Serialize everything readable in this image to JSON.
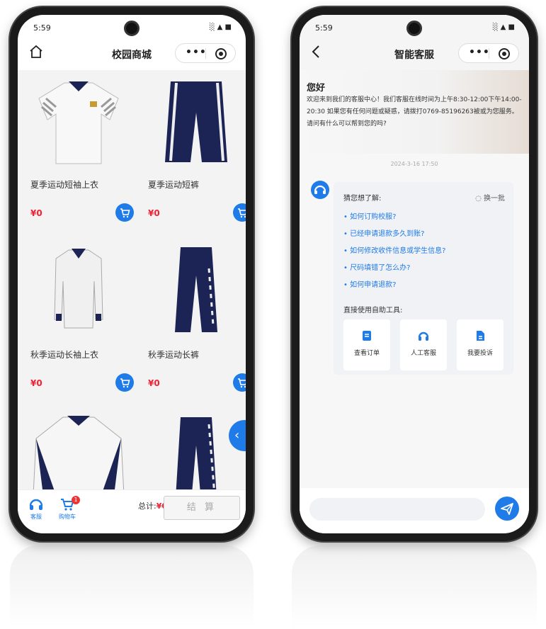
{
  "shop": {
    "status_time": "5:59",
    "status_icons": "░ ▲ ■",
    "title": "校园商城",
    "products": [
      {
        "name": "夏季运动短袖上衣",
        "price": "¥0"
      },
      {
        "name": "夏季运动短裤",
        "price": "¥0"
      },
      {
        "name": "秋季运动长袖上衣",
        "price": "¥0"
      },
      {
        "name": "秋季运动长裤",
        "price": "¥0"
      }
    ],
    "tab_service": "客服",
    "tab_cart": "购物车",
    "cart_count": "1",
    "total_label": "总计:",
    "total_value": "¥0",
    "checkout_label": "结 算"
  },
  "chat": {
    "status_time": "5:59",
    "status_icons": "░ ▲ ■",
    "title": "智能客服",
    "greeting": "您好",
    "welcome": "欢迎来到我们的客服中心！我们客服在线时间为上午8:30-12:00下午14:00-20:30 如果您有任何问题或疑惑，请拨打0769-85196263被或为您服务。请问有什么可以帮到您的吗?",
    "timestamp": "2024-3-16 17:50",
    "guess_label": "猜您想了解:",
    "refresh_label": "换一批",
    "faqs": [
      "• 如何订购校服?",
      "• 已经申请退款多久到账?",
      "• 如何修改收件信息或学生信息?",
      "• 尺码填错了怎么办?",
      "• 如何申请退款?"
    ],
    "tools_label": "直接使用自助工具:",
    "tools": [
      {
        "label": "查看订单",
        "icon": "order-icon"
      },
      {
        "label": "人工客服",
        "icon": "agent-icon"
      },
      {
        "label": "我要投诉",
        "icon": "complaint-icon"
      }
    ]
  },
  "colors": {
    "accent": "#1e7be8",
    "price": "#e22233",
    "badge": "#e33333"
  }
}
